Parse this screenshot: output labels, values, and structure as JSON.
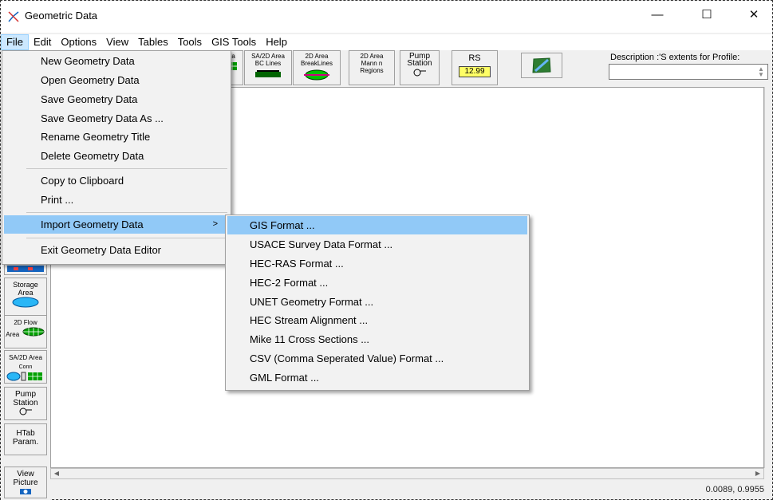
{
  "window": {
    "title": "Geometric Data",
    "minimize": "—",
    "maximize": "☐",
    "close": "✕"
  },
  "menubar": [
    "File",
    "Edit",
    "Options",
    "View",
    "Tables",
    "Tools",
    "GIS Tools",
    "Help"
  ],
  "toolbar": {
    "partial_label": "rea",
    "sa_bc": [
      "SA/2D Area",
      "BC Lines"
    ],
    "breaklines": [
      "2D Area",
      "BreakLines"
    ],
    "mann": [
      "2D Area",
      "Mann n",
      "Regions"
    ],
    "pump": [
      "Pump",
      "Station"
    ],
    "rs_label": "RS",
    "rs_value": "12.99",
    "description_label": "Description :'S extents for Profile:",
    "description_value": ""
  },
  "palette": {
    "storage": [
      "Storage",
      "Area"
    ],
    "flow2d": [
      "2D Flow",
      "Area"
    ],
    "conn": [
      "SA/2D Area",
      "Conn"
    ],
    "pump": [
      "Pump",
      "Station"
    ],
    "htab": [
      "HTab",
      "Param."
    ],
    "view": [
      "View",
      "Picture"
    ]
  },
  "file_menu": {
    "items": [
      "New Geometry Data",
      "Open Geometry Data",
      "Save Geometry Data",
      "Save Geometry Data As ...",
      "Rename Geometry Title",
      "Delete Geometry Data",
      "Copy to Clipboard",
      "Print ...",
      "Import Geometry Data",
      "Exit Geometry Data Editor"
    ],
    "submenu_arrow": ">"
  },
  "import_submenu": {
    "items": [
      "GIS Format ...",
      "USACE Survey Data Format ...",
      "HEC-RAS Format ...",
      "HEC-2 Format ...",
      "UNET Geometry Format ...",
      "HEC Stream Alignment ...",
      "Mike 11 Cross Sections ...",
      "CSV (Comma Seperated Value) Format ...",
      "GML Format ..."
    ]
  },
  "status": {
    "coords": "0.0089, 0.9955"
  },
  "colors": {
    "highlight": "#91c9f7",
    "menu_bg": "#f2f2f2",
    "rs_tag": "#ffff66",
    "storage_blue": "#29b6f6",
    "flow_green": "#00a000"
  }
}
